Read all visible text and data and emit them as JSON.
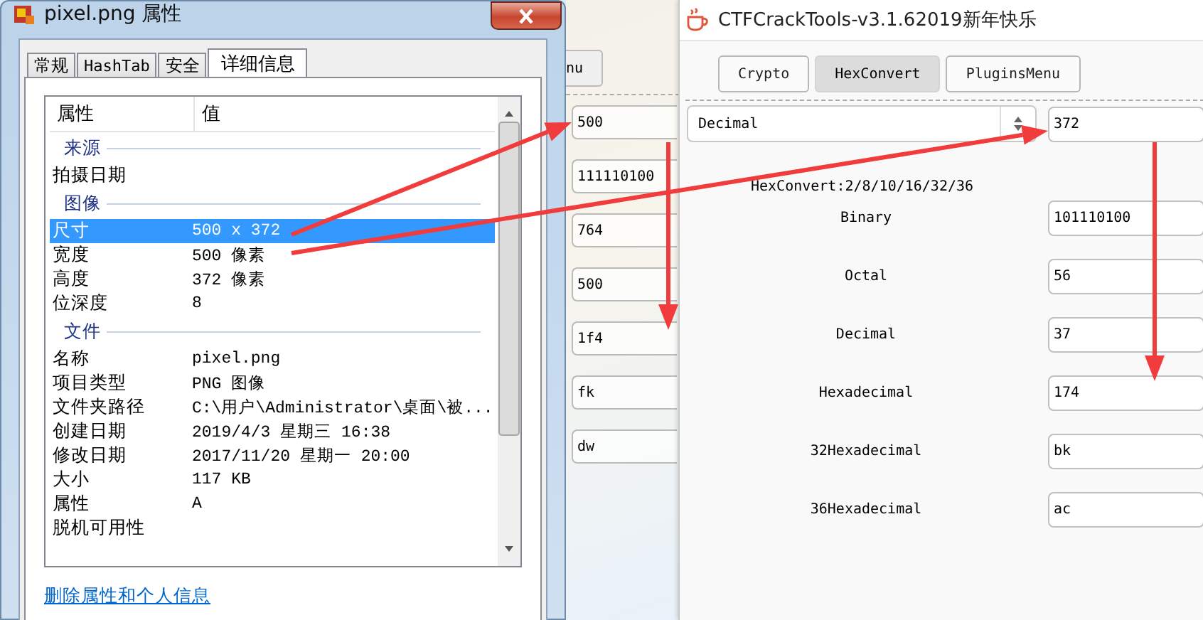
{
  "properties_window": {
    "title": "pixel.png 属性",
    "tabs": [
      {
        "label": "常规",
        "selected": false
      },
      {
        "label": "HashTab",
        "selected": false
      },
      {
        "label": "安全",
        "selected": false
      },
      {
        "label": "详细信息",
        "selected": true
      }
    ],
    "columns": [
      "属性",
      "值"
    ],
    "groups": [
      {
        "heading": "来源",
        "rows": [
          {
            "name": "拍摄日期",
            "selected": false
          }
        ]
      },
      {
        "heading": "图像",
        "rows": [
          {
            "name": "尺寸",
            "value": "500 x 372",
            "selected": true
          },
          {
            "name": "宽度",
            "value": "500 像素",
            "selected": false
          },
          {
            "name": "高度",
            "value": "372 像素",
            "selected": false
          },
          {
            "name": "位深度",
            "value": "8",
            "selected": false
          }
        ]
      },
      {
        "heading": "文件",
        "rows": [
          {
            "name": "名称",
            "value": "pixel.png",
            "selected": false
          },
          {
            "name": "项目类型",
            "value": "PNG 图像",
            "selected": false
          },
          {
            "name": "文件夹路径",
            "value": "C:\\用户\\Administrator\\桌面\\被...",
            "selected": false
          },
          {
            "name": "创建日期",
            "value": "2019/4/3 星期三 16:38",
            "selected": false
          },
          {
            "name": "修改日期",
            "value": "2017/11/20 星期一 20:00",
            "selected": false
          },
          {
            "name": "大小",
            "value": "117 KB",
            "selected": false
          },
          {
            "name": "属性",
            "value": "A",
            "selected": false
          },
          {
            "name": "脱机可用性",
            "selected": false
          }
        ]
      }
    ],
    "link": "删除属性和个人信息"
  },
  "background_window": {
    "tab": "nu",
    "fields": [
      "500",
      "111110100",
      "764",
      "500",
      "1f4",
      "fk",
      "dw"
    ]
  },
  "converter_window": {
    "title": "CTFCrackTools-v3.1.62019新年快乐",
    "tabs": [
      {
        "label": "Crypto",
        "selected": false
      },
      {
        "label": "HexConvert",
        "selected": true
      },
      {
        "label": "PluginsMenu",
        "selected": false
      }
    ],
    "base_select": "Decimal",
    "input": "372",
    "caption": "HexConvert:2/8/10/16/32/36",
    "rows": [
      {
        "label": "Binary",
        "value": "101110100"
      },
      {
        "label": "Octal",
        "value": "56"
      },
      {
        "label": "Decimal",
        "value": "37"
      },
      {
        "label": "Hexadecimal",
        "value": "174"
      },
      {
        "label": "32Hexadecimal",
        "value": "bk"
      },
      {
        "label": "36Hexadecimal",
        "value": "ac"
      }
    ]
  }
}
